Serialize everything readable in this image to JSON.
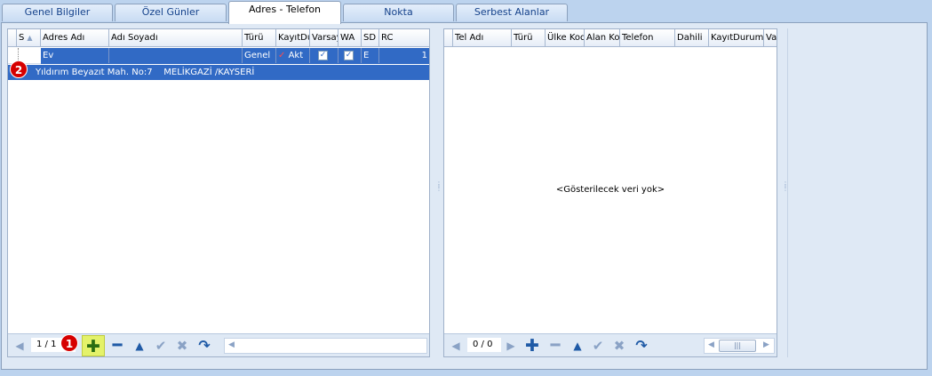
{
  "tabs": [
    {
      "label": "Genel Bilgiler"
    },
    {
      "label": "Özel Günler"
    },
    {
      "label": "Adres - Telefon"
    },
    {
      "label": "Nokta"
    },
    {
      "label": "Serbest Alanlar"
    }
  ],
  "address_grid": {
    "columns": [
      "S",
      "Adres Adı",
      "Adı Soyadı",
      "Türü",
      "KayıtDu",
      "Varsay",
      "WA",
      "SD",
      "RC"
    ],
    "rows": [
      {
        "adres_adi": "Ev",
        "adi_soyadi": "",
        "turu": "Genel",
        "kayit_durumu": "Akt",
        "varsayilan": "✓",
        "wa": "✓",
        "sd": "E",
        "rc": "1"
      }
    ],
    "preview": "Yıldırım Beyazıt Mah. No:7    MELİKGAZİ /KAYSERİ"
  },
  "address_nav": {
    "record_counter": "1 / 1"
  },
  "phone_grid": {
    "columns": [
      "Tel Adı",
      "Türü",
      "Ülke Kod",
      "Alan Ko",
      "Telefon",
      "Dahili",
      "KayıtDurumu",
      "Va"
    ],
    "empty_text": "<Gösterilecek veri yok>"
  },
  "phone_nav": {
    "record_counter": "0 / 0"
  },
  "badges": {
    "one": "1",
    "two": "2"
  },
  "icons": {
    "first": "triangle-left-icon",
    "add": "plus-icon",
    "remove": "minus-icon",
    "up": "triangle-up-icon",
    "confirm": "check-icon",
    "cancel": "x-icon",
    "refresh": "refresh-icon"
  },
  "colors": {
    "selection": "#316ac5",
    "badge": "#d60000",
    "nav_icon": "#1f5aa6",
    "add_highlight": "#e4f26a"
  }
}
